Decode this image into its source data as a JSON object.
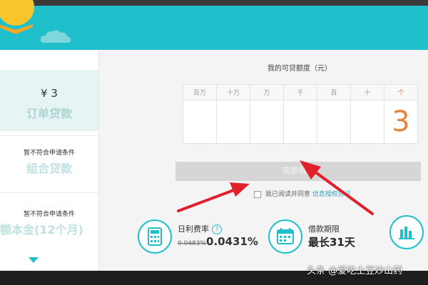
{
  "sidebar": {
    "card1": {
      "amount": "¥ 3",
      "title": "订单贷款"
    },
    "card2": {
      "note": "暂不符合申请条件",
      "title": "组合贷款"
    },
    "card3": {
      "note": "暂不符合申请条件",
      "title": "额本金(12个月)"
    }
  },
  "quota": {
    "title": "我的可贷额度（元）",
    "columns": [
      "百万",
      "十万",
      "万",
      "千",
      "百",
      "十",
      "个"
    ],
    "digits": [
      "",
      "",
      "",
      "",
      "",
      "",
      "3"
    ],
    "active_column_color": "#e8833a"
  },
  "borrow_button_label": "我要借钱",
  "agreement": {
    "checkbox_checked": false,
    "text": "我已阅读并同意",
    "link_text": "信息授权协议"
  },
  "rate": {
    "label": "日利费率",
    "help_icon": "?",
    "old_value": "0.0483%",
    "new_value": "0.0431%"
  },
  "term": {
    "label": "借款期限",
    "value": "最长31天"
  },
  "icons": {
    "rate": "calculator-icon",
    "term": "calendar-icon",
    "extra": "bar-chart-icon"
  },
  "colors": {
    "brand": "#1fbfcc",
    "digit": "#e8833a",
    "arrow": "#e0202a"
  },
  "watermark": "头条 @爱吃土豆炒山药"
}
